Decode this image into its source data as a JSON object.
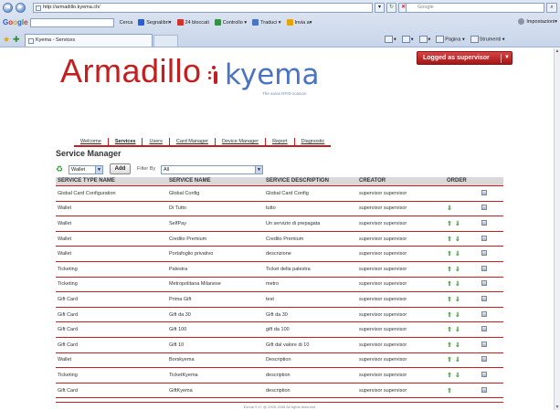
{
  "browser": {
    "url": "http://armadillo.kyema.ch/",
    "search_placeholder": "Google",
    "toolbar": {
      "cerca": "Cerca",
      "segnalibri": "Segnalibri▾",
      "bloccati": "24 bloccati",
      "controllo": "Controllo ▾",
      "traduci": "Traduci ▾",
      "invia": "Invia a▾",
      "impostazioni": "Impostazioni▾"
    },
    "tab_title": "Kyema - Services",
    "cmd": {
      "pagina": "Pagina ▾",
      "strumenti": "Strumenti ▾"
    }
  },
  "header": {
    "brand": "Armadillo",
    "kyema": "kyema",
    "kyema_tagline": "The swiss RFID solution",
    "logged_in": "Logged as supervisor"
  },
  "menu": [
    "Welcome",
    "Services",
    "Users",
    "Card Manager",
    "Device Manager",
    "Report",
    "Diagnostic"
  ],
  "active_menu": "Services",
  "title": "Service Manager",
  "toolbar": {
    "type_select": "Wallet",
    "add_label": "Add",
    "filter_label": "Filter By",
    "filter_value": "All"
  },
  "table": {
    "columns": [
      "SERVICE TYPE NAME",
      "SERVICE NAME",
      "SERVICE DESCRIPTION",
      "CREATOR",
      "ORDER"
    ],
    "rows": [
      {
        "type": "Global Card Configuration",
        "name": "Global Config",
        "desc": "Global Card Config",
        "creator": "supervisor supervisor",
        "order": ""
      },
      {
        "type": "Wallet",
        "name": "Di Tutto",
        "desc": "tutto",
        "creator": "supervisor supervisor",
        "order": "⇓"
      },
      {
        "type": "Wallet",
        "name": "SelfPay",
        "desc": "Un servizio di prepagata",
        "creator": "supervisor supervisor",
        "order": "⇑⇓"
      },
      {
        "type": "Wallet",
        "name": "Credito Premium",
        "desc": "Credito Premium",
        "creator": "supervisor supervisor",
        "order": "⇑⇓"
      },
      {
        "type": "Wallet",
        "name": "Portafoglio privativo",
        "desc": "descrizione",
        "creator": "supervisor supervisor",
        "order": "⇑⇓"
      },
      {
        "type": "Ticketing",
        "name": "Palestra",
        "desc": "Ticket della palestra",
        "creator": "supervisor supervisor",
        "order": "⇑⇓"
      },
      {
        "type": "Ticketing",
        "name": "Metropolitana Milanese",
        "desc": "metro",
        "creator": "supervisor supervisor",
        "order": "⇑⇓"
      },
      {
        "type": "Gift Card",
        "name": "Prima Gift",
        "desc": "test",
        "creator": "supervisor supervisor",
        "order": "⇑⇓"
      },
      {
        "type": "Gift Card",
        "name": "Gift da 30",
        "desc": "Gift da 30",
        "creator": "supervisor supervisor",
        "order": "⇑⇓"
      },
      {
        "type": "Gift Card",
        "name": "Gift 100",
        "desc": "gift da 100",
        "creator": "supervisor supervisor",
        "order": "⇑⇓"
      },
      {
        "type": "Gift Card",
        "name": "Gift 10",
        "desc": "Gift dal valore di 10",
        "creator": "supervisor supervisor",
        "order": "⇑⇓"
      },
      {
        "type": "Wallet",
        "name": "Borskyema",
        "desc": "Description",
        "creator": "supervisor supervisor",
        "order": "⇑⇓"
      },
      {
        "type": "Ticketing",
        "name": "TicketKyema",
        "desc": "description",
        "creator": "supervisor supervisor",
        "order": "⇑⇓"
      },
      {
        "type": "Gift Card",
        "name": "GiftKyema",
        "desc": "description",
        "creator": "supervisor supervisor",
        "order": "⇑"
      }
    ]
  },
  "footer": "Exmia S.r.l. @ 2005-2008 All rights reserved"
}
